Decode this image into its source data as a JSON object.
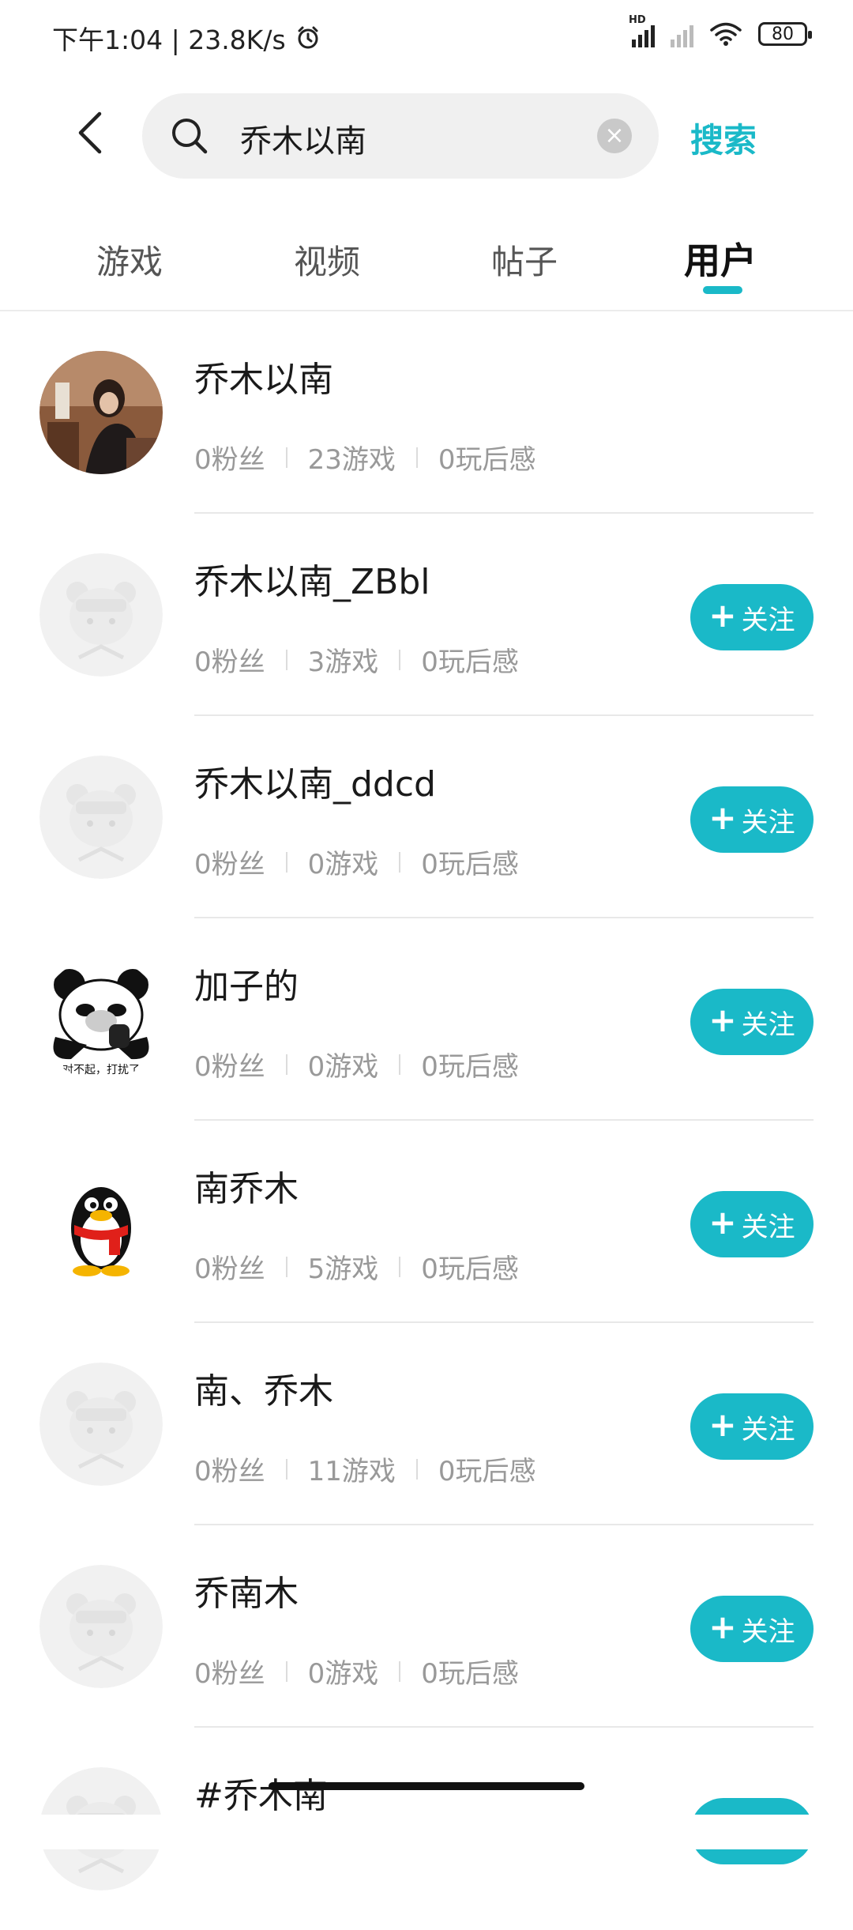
{
  "status_bar": {
    "time_speed": "下午1:04 | 23.8K/s",
    "battery": "80",
    "network_badge": "HD"
  },
  "search": {
    "query": "乔木以南",
    "button_label": "搜索"
  },
  "tabs": [
    {
      "label": "游戏"
    },
    {
      "label": "视频"
    },
    {
      "label": "帖子"
    },
    {
      "label": "用户"
    }
  ],
  "active_tab": "用户",
  "follow_label": "关注",
  "accent_color": "#1ab9c8",
  "users": [
    {
      "name": "乔木以南",
      "fans": "0粉丝",
      "games": "23游戏",
      "reviews": "0玩后感",
      "avatar": "photo-avatar",
      "show_follow": false
    },
    {
      "name": "乔木以南_ZBbl",
      "fans": "0粉丝",
      "games": "3游戏",
      "reviews": "0玩后感",
      "avatar": "default-avatar",
      "show_follow": true
    },
    {
      "name": "乔木以南_ddcd",
      "fans": "0粉丝",
      "games": "0游戏",
      "reviews": "0玩后感",
      "avatar": "default-avatar",
      "show_follow": true
    },
    {
      "name": "加子的",
      "fans": "0粉丝",
      "games": "0游戏",
      "reviews": "0玩后感",
      "avatar": "panda-meme-avatar",
      "show_follow": true
    },
    {
      "name": "南乔木",
      "fans": "0粉丝",
      "games": "5游戏",
      "reviews": "0玩后感",
      "avatar": "penguin-avatar",
      "show_follow": true
    },
    {
      "name": "南、乔木",
      "fans": "0粉丝",
      "games": "11游戏",
      "reviews": "0玩后感",
      "avatar": "default-avatar",
      "show_follow": true
    },
    {
      "name": "乔南木",
      "fans": "0粉丝",
      "games": "0游戏",
      "reviews": "0玩后感",
      "avatar": "default-avatar",
      "show_follow": true
    },
    {
      "name": "#乔木南",
      "fans": "",
      "games": "",
      "reviews": "",
      "avatar": "default-avatar",
      "show_follow": true
    }
  ]
}
